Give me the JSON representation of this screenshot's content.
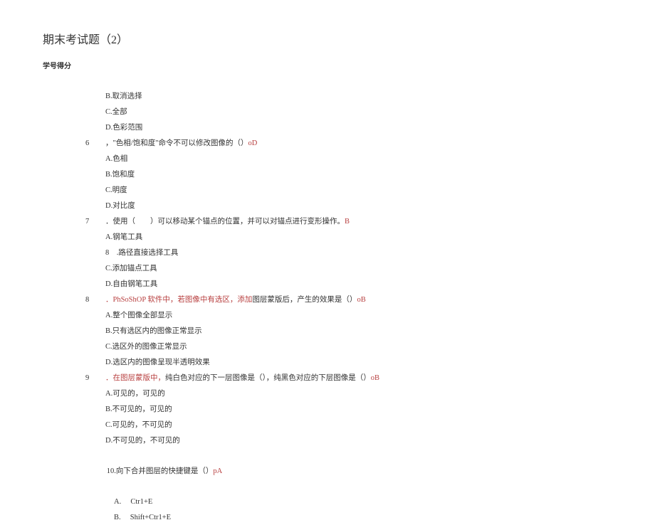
{
  "title": "期末考试题（2）",
  "subtitle": "学号得分",
  "lines": {
    "optB": "B.取消选择",
    "optC": "C.全部",
    "optD": "D.色彩范围",
    "q6num": "6",
    "q6textA": "，\"色相/饱和度\"命令不可以修改图像的（）",
    "q6textB": "oD",
    "q6a": "A.色相",
    "q6b": "B.饱和度",
    "q6c": "C.明度",
    "q6d": "D.对比度",
    "q7num": "7",
    "q7textA": "．使用（　　）可以移动某个锚点的位置，并可以对锚点进行变形操作。",
    "q7textB": "B",
    "q7a": "A.钢笔工具",
    "q7sub8": "8　.路径直接选择工具",
    "q7c": "C.添加锚点工具",
    "q7d": "D.自由钢笔工具",
    "q8num": "8",
    "q8textA": "．PhSoShOP 软件中，若图像中有选区，添加",
    "q8textB": "图层蒙版后，产生的效果是（）",
    "q8textC": "oB",
    "q8a": "A.整个图像全部显示",
    "q8b": "B.只有选区内的图像正常显示",
    "q8c": "C.选区外的图像正常显示",
    "q8d": "D.选区内的图像呈现半透明效果",
    "q9num": "9",
    "q9textA": "．在图层蒙版中，",
    "q9textB": "纯白色对应的下一层图像是（），纯黑色对应的下层图像是（）",
    "q9textC": "oB",
    "q9a": "A.可见的，可见的",
    "q9b": "B.不可见的，可见的",
    "q9c": "C.可见的，不可见的",
    "q9d": "D.不可见的，不可见的",
    "q10textA": "10.向下合并图层的快捷键是（）",
    "q10textB": "pA",
    "q10a": "A.　 Ctr1+E",
    "q10b": "B.　 Shift+Ctr1+E"
  }
}
